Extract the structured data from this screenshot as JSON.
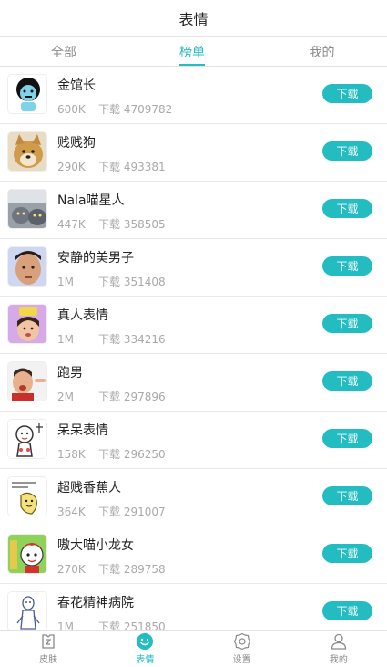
{
  "header": {
    "title": "表情"
  },
  "tabs": [
    {
      "label": "全部",
      "active": false
    },
    {
      "label": "榜单",
      "active": true
    },
    {
      "label": "我的",
      "active": false
    }
  ],
  "download_prefix": "下载",
  "items": [
    {
      "name": "金馆长",
      "size": "600K",
      "downloads": "4709782",
      "button": "下载"
    },
    {
      "name": "贱贱狗",
      "size": "290K",
      "downloads": "493381",
      "button": "下载"
    },
    {
      "name": "Nala喵星人",
      "size": "447K",
      "downloads": "358505",
      "button": "下载"
    },
    {
      "name": "安静的美男子",
      "size": "1M",
      "downloads": "351408",
      "button": "下载"
    },
    {
      "name": "真人表情",
      "size": "1M",
      "downloads": "334216",
      "button": "下载"
    },
    {
      "name": "跑男",
      "size": "2M",
      "downloads": "297896",
      "button": "下载"
    },
    {
      "name": "呆呆表情",
      "size": "158K",
      "downloads": "296250",
      "button": "下载"
    },
    {
      "name": "超贱香蕉人",
      "size": "364K",
      "downloads": "291007",
      "button": "下载"
    },
    {
      "name": "嗷大喵小龙女",
      "size": "270K",
      "downloads": "289758",
      "button": "下载"
    },
    {
      "name": "春花精神病院",
      "size": "1M",
      "downloads": "251850",
      "button": "下载"
    }
  ],
  "bottom_nav": [
    {
      "label": "皮肤",
      "icon": "skin-icon",
      "active": false
    },
    {
      "label": "表情",
      "icon": "smiley-icon",
      "active": true
    },
    {
      "label": "设置",
      "icon": "gear-icon",
      "active": false
    },
    {
      "label": "我的",
      "icon": "person-icon",
      "active": false
    }
  ],
  "colors": {
    "accent": "#22bcc1",
    "text": "#222222",
    "muted": "#a9a9a9"
  }
}
